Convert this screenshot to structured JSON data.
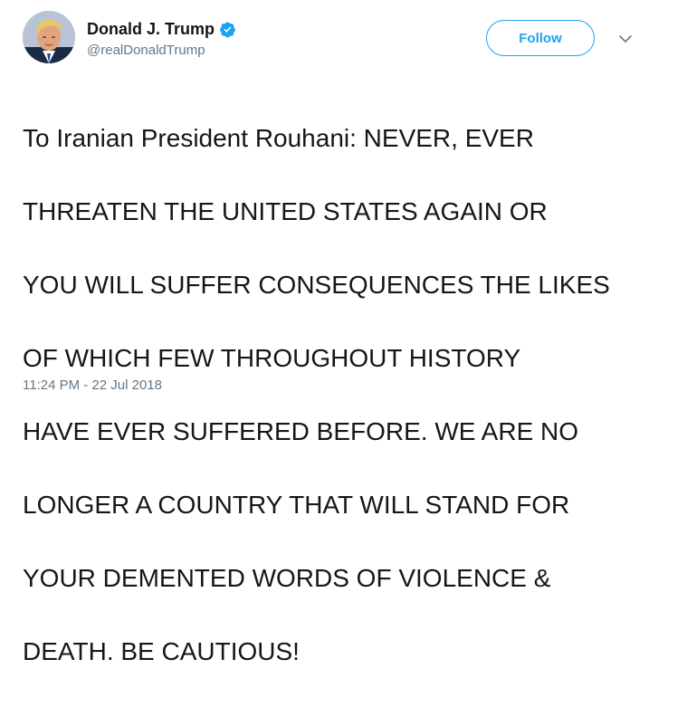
{
  "author": {
    "display_name": "Donald J. Trump",
    "handle": "@realDonaldTrump",
    "verified": true,
    "avatar_icon": "profile-photo"
  },
  "actions": {
    "follow_label": "Follow",
    "more_icon": "chevron-down-icon"
  },
  "tweet": {
    "lines": [
      "To Iranian President Rouhani: NEVER, EVER",
      "THREATEN THE UNITED STATES AGAIN OR",
      "YOU WILL SUFFER CONSEQUENCES THE LIKES",
      "OF WHICH FEW THROUGHOUT HISTORY",
      "HAVE EVER SUFFERED BEFORE. WE ARE NO",
      "LONGER A COUNTRY THAT WILL STAND FOR",
      "YOUR DEMENTED WORDS OF VIOLENCE &",
      "DEATH. BE CAUTIOUS!"
    ],
    "timestamp": "11:24 PM - 22 Jul 2018"
  },
  "colors": {
    "accent": "#1da1f2",
    "text": "#14171a",
    "secondary_text": "#657786"
  }
}
